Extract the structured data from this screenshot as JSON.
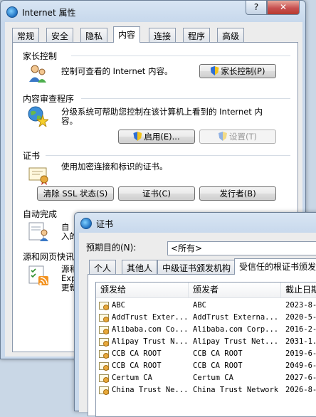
{
  "main_window": {
    "title": "Internet 属性",
    "help_button": "?",
    "close_button": "✕",
    "tabs": [
      "常规",
      "安全",
      "隐私",
      "内容",
      "连接",
      "程序",
      "高级"
    ],
    "active_tab": "内容",
    "parental": {
      "title": "家长控制",
      "description": "控制可查看的 Internet 内容。",
      "button": "家长控制(P)"
    },
    "advisor": {
      "title": "内容审查程序",
      "description_line1": "分级系统可帮助您控制在该计算机上看到的 Internet 内",
      "description_line2": "容。",
      "enable_button": "启用(E)...",
      "settings_button": "设置(T)"
    },
    "certificates": {
      "title": "证书",
      "description": "使用加密连接和标识的证书。",
      "clear_ssl_button": "清除 SSL 状态(S)",
      "certificates_button": "证书(C)",
      "publishers_button": "发行者(B)"
    },
    "autocomplete": {
      "title": "自动完成",
      "desc_partial1": "自",
      "desc_partial2": "入的"
    },
    "feeds": {
      "title": "源和网页快讯",
      "desc_partial1": "源和",
      "desc_partial2": "Exp",
      "desc_partial3": "更新"
    }
  },
  "cert_window": {
    "title": "证书",
    "purpose_label": "预期目的(N):",
    "purpose_value": "<所有>",
    "tabs": [
      "个人",
      "其他人",
      "中级证书颁发机构",
      "受信任的根证书颁发机"
    ],
    "active_tab": "受信任的根证书颁发机",
    "columns": [
      "颁发给",
      "颁发者",
      "截止日期"
    ],
    "rows": [
      {
        "issued_to": "ABC",
        "issued_by": "ABC",
        "expires": "2023-8-"
      },
      {
        "issued_to": "AddTrust Exter...",
        "issued_by": "AddTrust Externa...",
        "expires": "2020-5-"
      },
      {
        "issued_to": "Alibaba.com Co...",
        "issued_by": "Alibaba.com Corp...",
        "expires": "2016-2-"
      },
      {
        "issued_to": "Alipay Trust N...",
        "issued_by": "Alipay Trust Net...",
        "expires": "2031-1."
      },
      {
        "issued_to": "CCB CA ROOT",
        "issued_by": "CCB CA ROOT",
        "expires": "2019-6-"
      },
      {
        "issued_to": "CCB CA ROOT",
        "issued_by": "CCB CA ROOT",
        "expires": "2049-6-"
      },
      {
        "issued_to": "Certum CA",
        "issued_by": "Certum CA",
        "expires": "2027-6-"
      },
      {
        "issued_to": "China Trust Ne...",
        "issued_by": "China Trust Network",
        "expires": "2026-8-"
      }
    ]
  }
}
